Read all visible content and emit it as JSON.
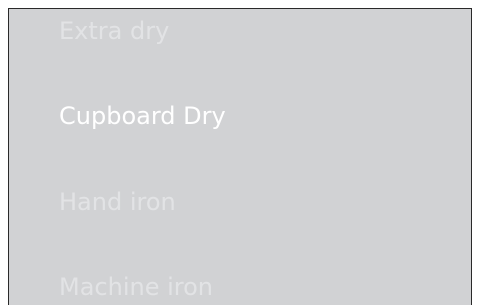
{
  "dry_program_picker": {
    "selected_index": 1,
    "options": [
      {
        "label": "Extra dry"
      },
      {
        "label": "Cupboard Dry"
      },
      {
        "label": "Hand iron"
      },
      {
        "label": "Machine iron"
      }
    ]
  },
  "colors": {
    "panel_background": "#d1d2d4",
    "selected_text": "#ffffff",
    "unselected_text": "#e2e3e5",
    "panel_border": "#2a2a2a"
  }
}
